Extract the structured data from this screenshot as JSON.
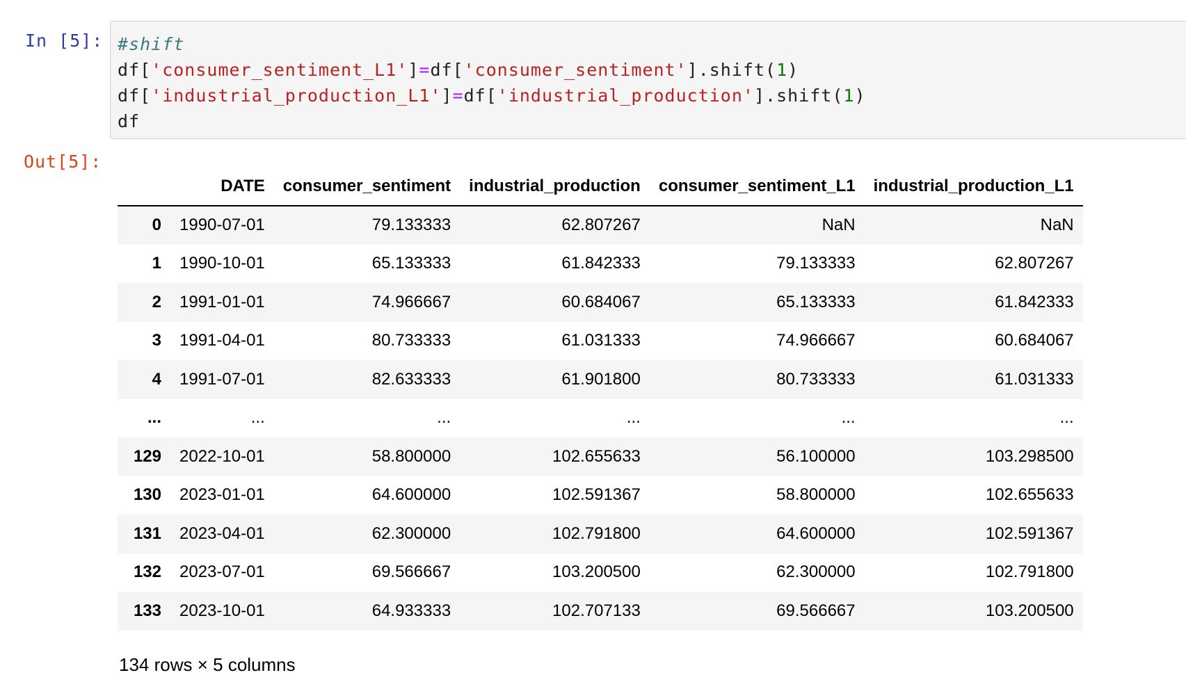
{
  "input_prompt": "In [5]:",
  "output_prompt": "Out[5]:",
  "code": {
    "line1_comment": "#shift",
    "line2": {
      "a": "df[",
      "b": "'consumer_sentiment_L1'",
      "c": "]",
      "d": "=",
      "e": "df[",
      "f": "'consumer_sentiment'",
      "g": "].shift(",
      "h": "1",
      "i": ")"
    },
    "line3": {
      "a": "df[",
      "b": "'industrial_production_L1'",
      "c": "]",
      "d": "=",
      "e": "df[",
      "f": "'industrial_production'",
      "g": "].shift(",
      "h": "1",
      "i": ")"
    },
    "line4": "df"
  },
  "table": {
    "columns": [
      "",
      "DATE",
      "consumer_sentiment",
      "industrial_production",
      "consumer_sentiment_L1",
      "industrial_production_L1"
    ],
    "rows": [
      [
        "0",
        "1990-07-01",
        "79.133333",
        "62.807267",
        "NaN",
        "NaN"
      ],
      [
        "1",
        "1990-10-01",
        "65.133333",
        "61.842333",
        "79.133333",
        "62.807267"
      ],
      [
        "2",
        "1991-01-01",
        "74.966667",
        "60.684067",
        "65.133333",
        "61.842333"
      ],
      [
        "3",
        "1991-04-01",
        "80.733333",
        "61.031333",
        "74.966667",
        "60.684067"
      ],
      [
        "4",
        "1991-07-01",
        "82.633333",
        "61.901800",
        "80.733333",
        "61.031333"
      ],
      [
        "...",
        "...",
        "...",
        "...",
        "...",
        "..."
      ],
      [
        "129",
        "2022-10-01",
        "58.800000",
        "102.655633",
        "56.100000",
        "103.298500"
      ],
      [
        "130",
        "2023-01-01",
        "64.600000",
        "102.591367",
        "58.800000",
        "102.655633"
      ],
      [
        "131",
        "2023-04-01",
        "62.300000",
        "102.791800",
        "64.600000",
        "102.591367"
      ],
      [
        "132",
        "2023-07-01",
        "69.566667",
        "103.200500",
        "62.300000",
        "102.791800"
      ],
      [
        "133",
        "2023-10-01",
        "64.933333",
        "102.707133",
        "69.566667",
        "103.200500"
      ]
    ]
  },
  "shape_note": "134 rows × 5 columns"
}
